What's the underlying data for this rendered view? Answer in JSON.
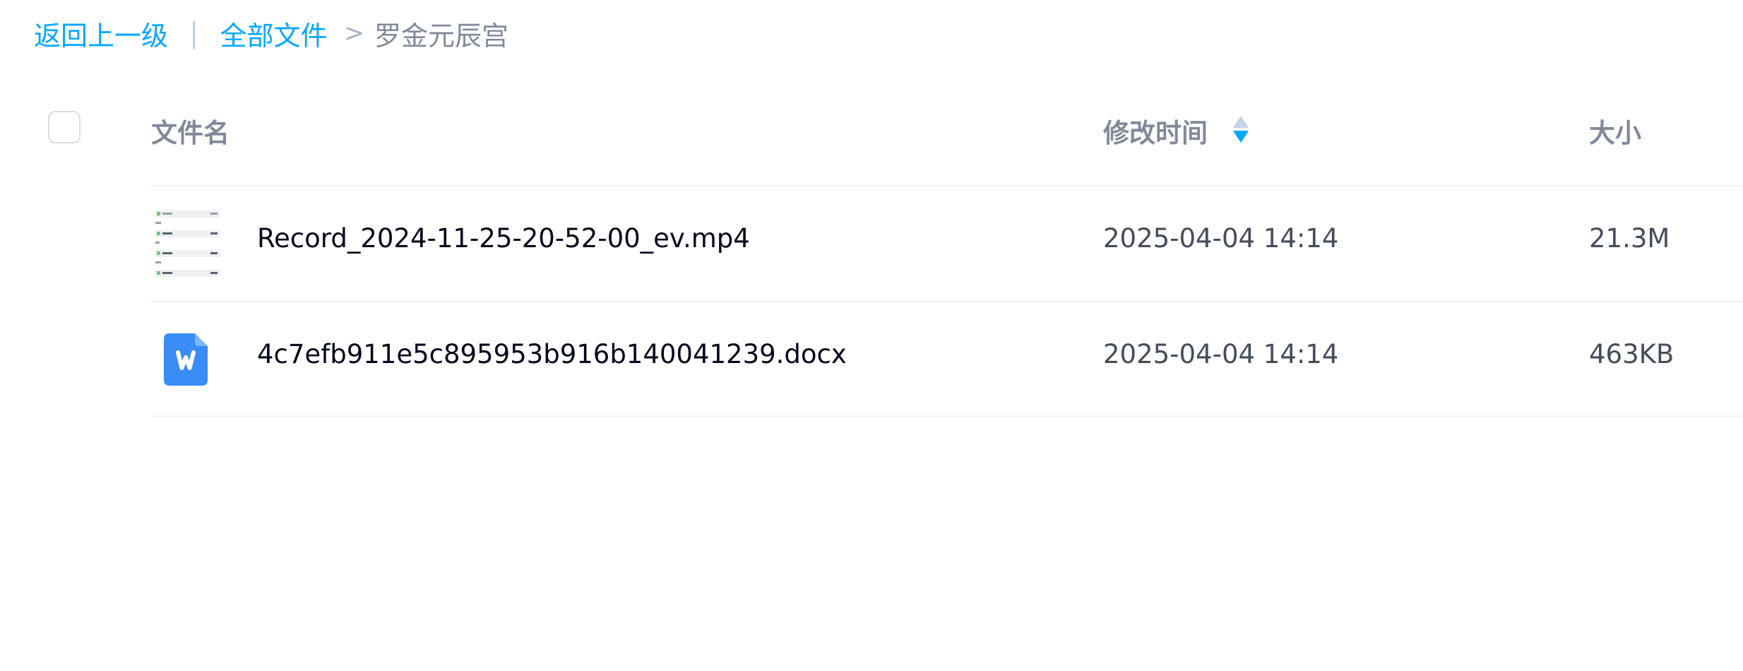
{
  "breadcrumb": {
    "back_label": "返回上一级",
    "divider": "|",
    "root_label": "全部文件",
    "separator": ">",
    "current_label": "罗金元辰宫"
  },
  "table": {
    "columns": {
      "name": "文件名",
      "modified": "修改时间",
      "size": "大小"
    },
    "sort_icon": "sort-toggle-icon",
    "rows": [
      {
        "thumbnail": "video-thumbnail",
        "name": "Record_2024-11-25-20-52-00_ev.mp4",
        "modified": "2025-04-04 14:14",
        "size": "21.3M"
      },
      {
        "thumbnail": "word-document-icon",
        "name": "4c7efb911e5c895953b916b140041239.docx",
        "modified": "2025-04-04 14:14",
        "size": "463KB"
      }
    ]
  },
  "colors": {
    "link": "#06a7ff",
    "header_text": "#818999",
    "primary_text": "#03081a",
    "secondary_text": "#454d5a",
    "word_blue": "#3a8cf6"
  }
}
